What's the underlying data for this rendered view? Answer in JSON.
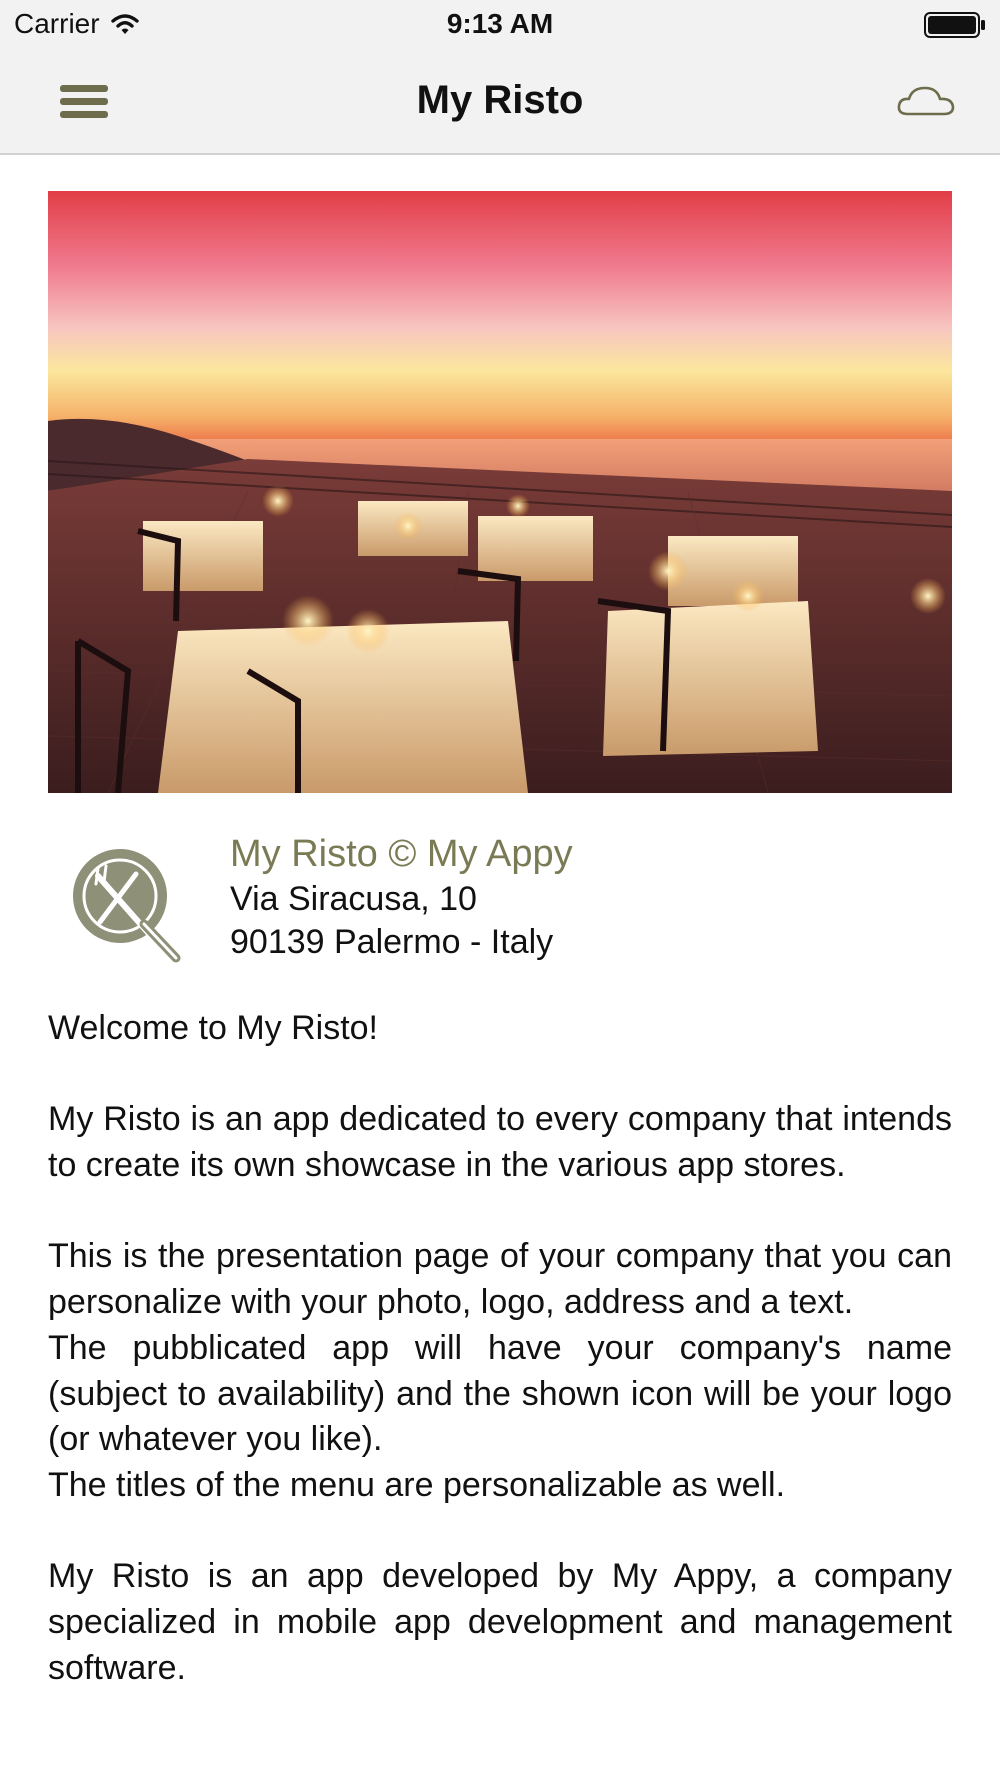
{
  "status_bar": {
    "carrier": "Carrier",
    "time": "9:13 AM",
    "wifi_icon": "wifi-icon",
    "battery_icon": "battery-icon"
  },
  "nav": {
    "title": "My Risto",
    "menu_icon": "hamburger-menu-icon",
    "cloud_icon": "cloud-icon",
    "accent_color": "#6d6c4c"
  },
  "hero": {
    "description": "sunset restaurant terrace"
  },
  "info": {
    "logo_icon": "fork-knife-plate-icon",
    "name": "My Risto © My Appy",
    "address_line1": "Via Siracusa, 10",
    "address_line2": "90139 Palermo - Italy",
    "name_color": "#7a7a55"
  },
  "content": {
    "welcome": "Welcome to My Risto!",
    "p1": "My Risto is an app dedicated to every company that intends to create its own showcase in the various app stores.",
    "p2": "This is the presentation page of your company that you can personalize with your photo, logo, address and a text.",
    "p3": "The pubblicated app will have your company's name (subject to availability) and the shown icon will be your logo (or whatever you like).",
    "p4": "The titles of the menu are personalizable as well.",
    "p5": "My Risto is an app developed by My Appy, a company specialized in mobile app development and management software."
  }
}
